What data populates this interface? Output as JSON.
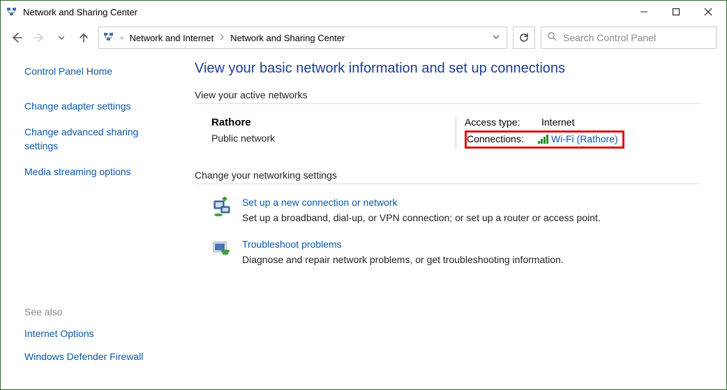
{
  "window": {
    "title": "Network and Sharing Center"
  },
  "nav": {
    "breadcrumb": {
      "seg1": "Network and Internet",
      "seg2": "Network and Sharing Center"
    },
    "search_placeholder": "Search Control Panel"
  },
  "sidebar": {
    "items": [
      {
        "label": "Control Panel Home"
      },
      {
        "label": "Change adapter settings"
      },
      {
        "label": "Change advanced sharing settings"
      },
      {
        "label": "Media streaming options"
      }
    ],
    "seealso_header": "See also",
    "seealso": [
      {
        "label": "Internet Options"
      },
      {
        "label": "Windows Defender Firewall"
      }
    ]
  },
  "main": {
    "page_title": "View your basic network information and set up connections",
    "active_header": "View your active networks",
    "network": {
      "name": "Rathore",
      "type": "Public network",
      "access_label": "Access type:",
      "access_value": "Internet",
      "conn_label": "Connections:",
      "conn_value": "Wi-Fi (Rathore)"
    },
    "change_header": "Change your networking settings",
    "settings": [
      {
        "title": "Set up a new connection or network",
        "desc": "Set up a broadband, dial-up, or VPN connection; or set up a router or access point."
      },
      {
        "title": "Troubleshoot problems",
        "desc": "Diagnose and repair network problems, or get troubleshooting information."
      }
    ]
  }
}
